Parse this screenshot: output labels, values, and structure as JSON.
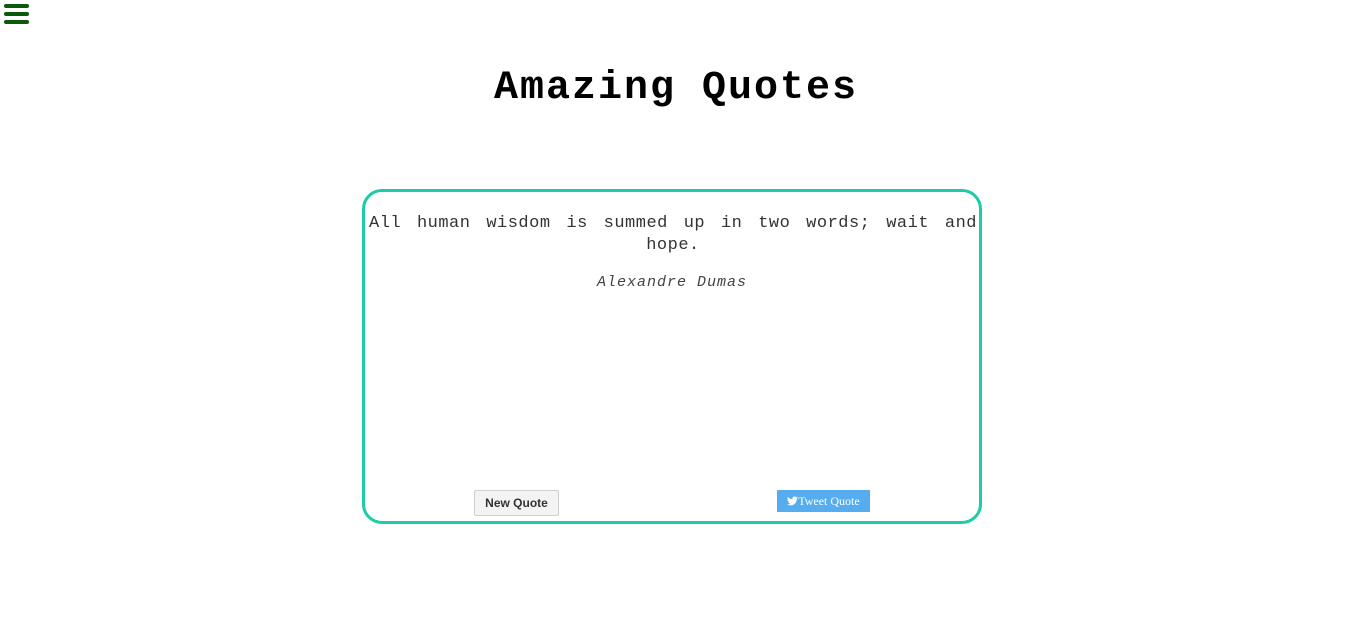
{
  "header": {
    "title": "Amazing Quotes"
  },
  "menu": {
    "icon": "hamburger-menu-icon",
    "color": "#0b5a0b"
  },
  "quote": {
    "text": "All human wisdom is summed up in two words; wait and hope.",
    "author": "Alexandre Dumas"
  },
  "actions": {
    "new_quote_label": "New Quote",
    "tweet_label": "Tweet Quote",
    "tweet_icon": "twitter-bird-icon"
  },
  "colors": {
    "card_border": "#1ccba7",
    "tweet_button": "#55acee"
  }
}
